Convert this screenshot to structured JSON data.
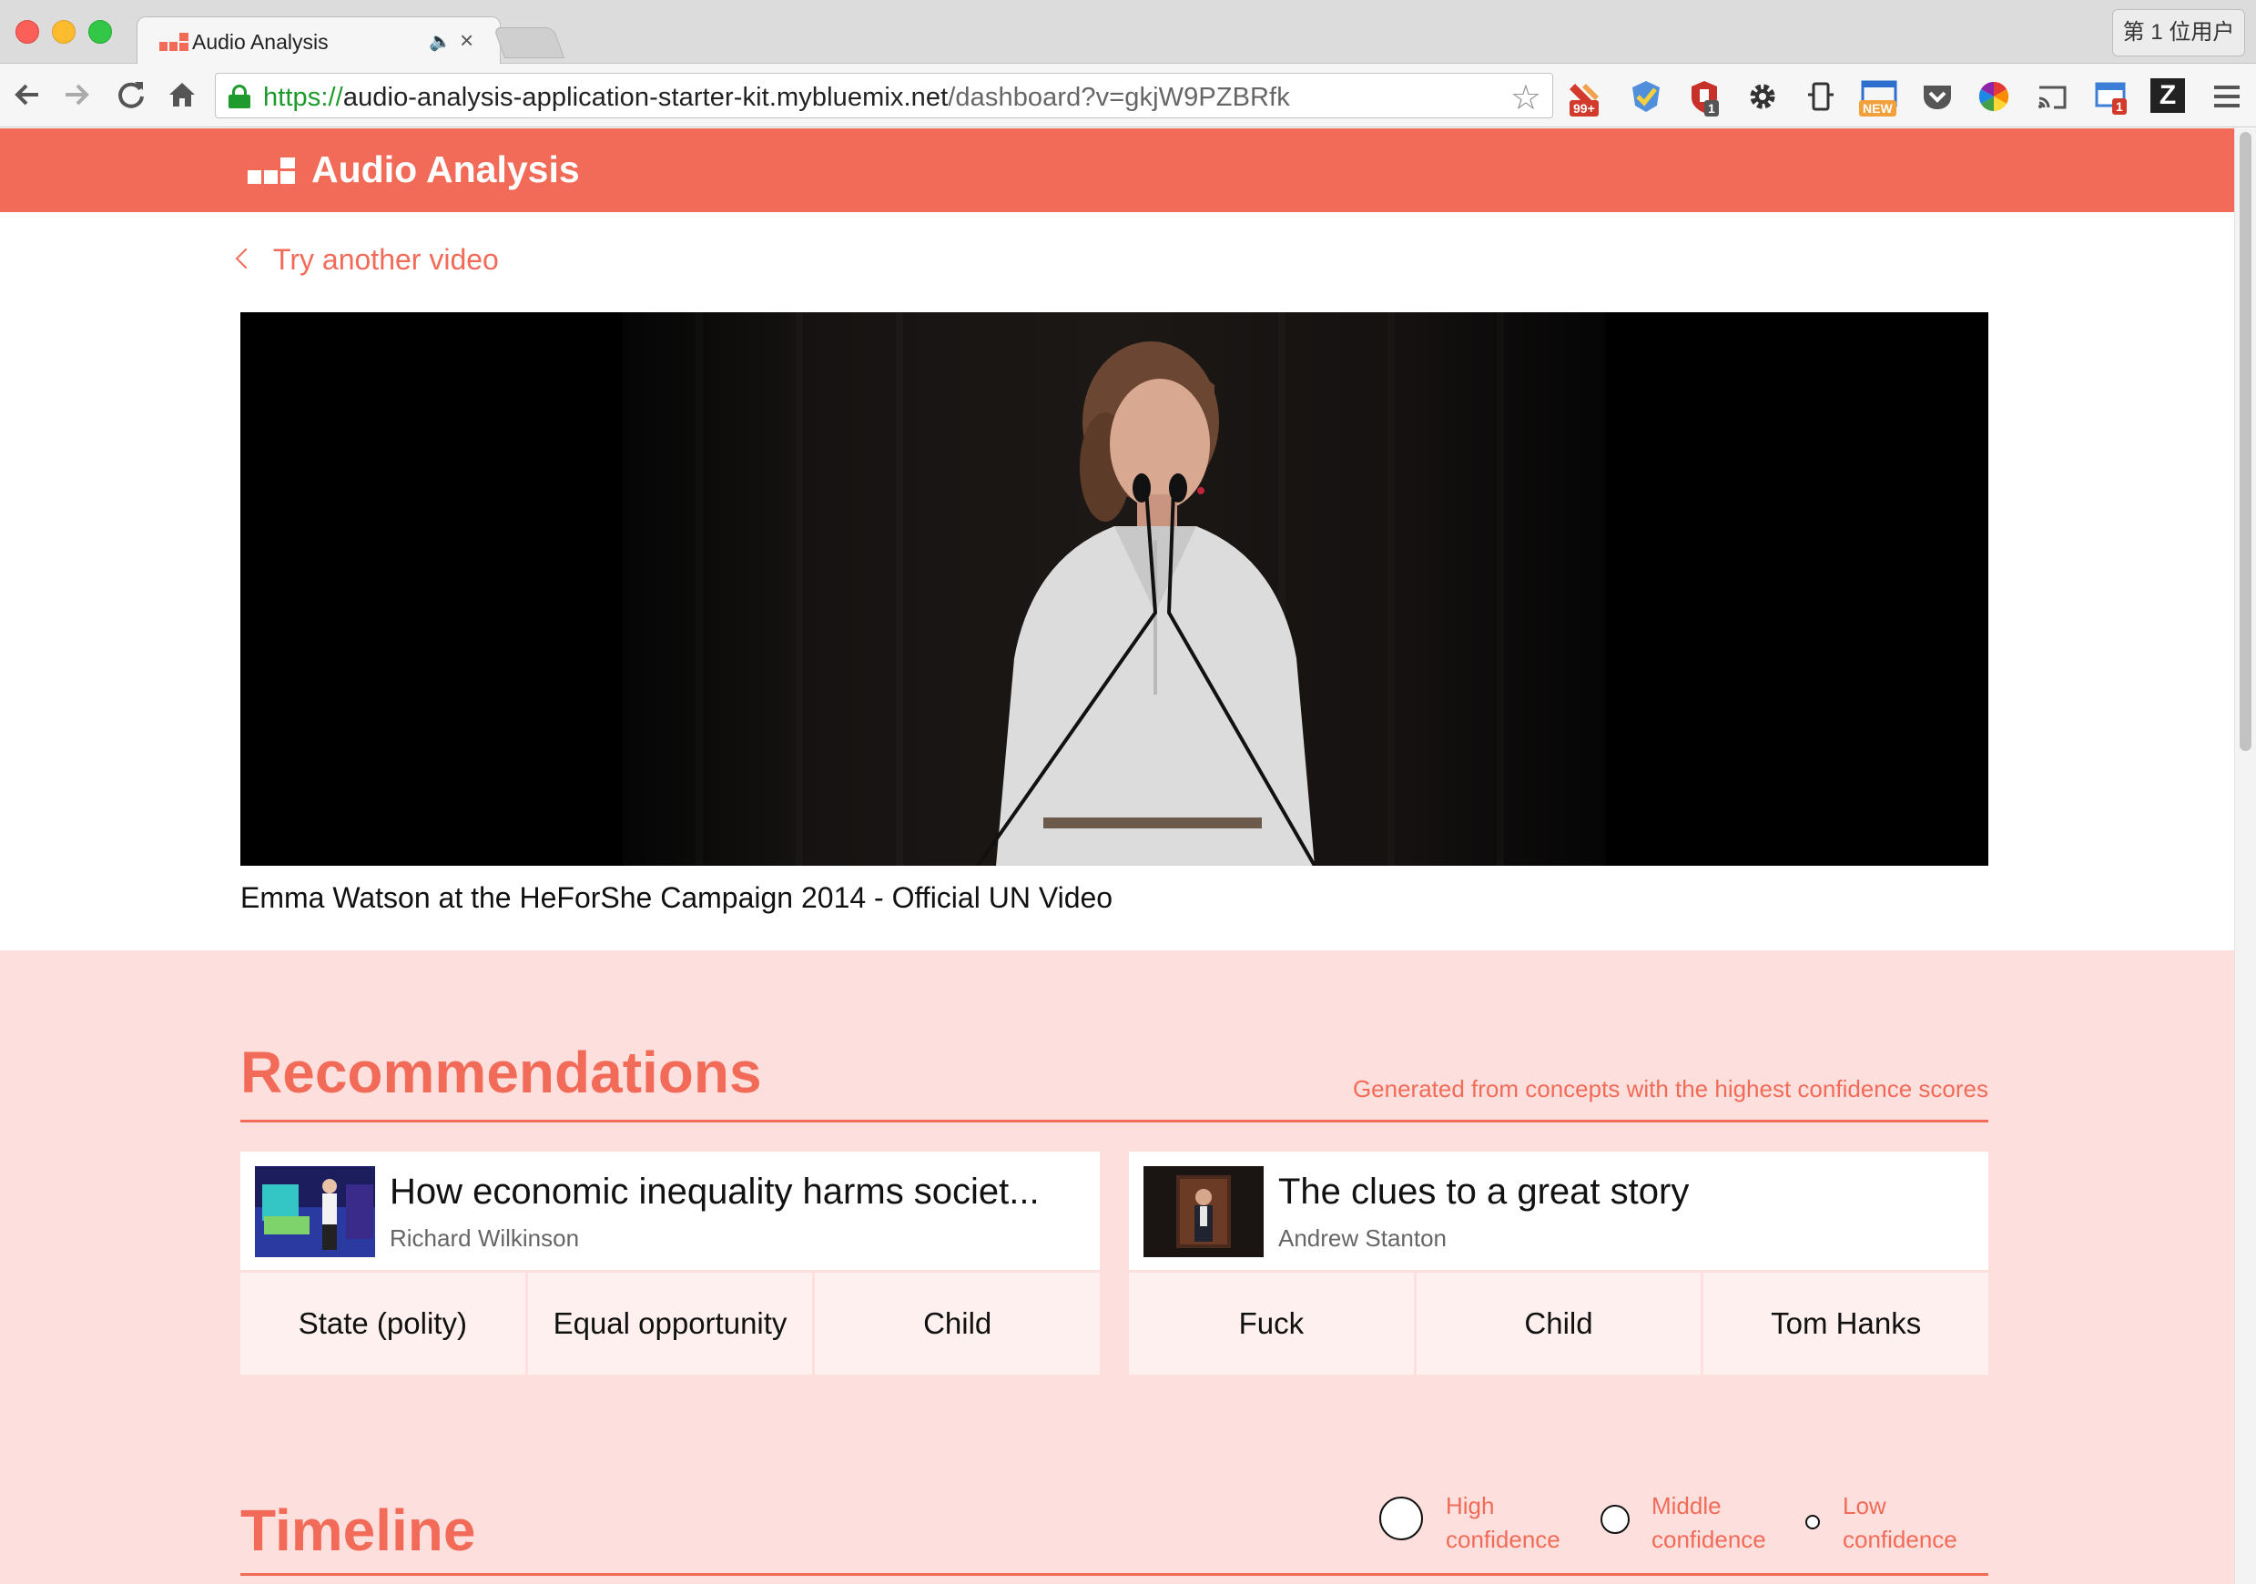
{
  "browser": {
    "tab": {
      "title": "Audio Analysis"
    },
    "user_label": "第 1 位用户",
    "url": {
      "scheme": "https://",
      "host": "audio-analysis-application-starter-kit.mybluemix.net",
      "path": "/dashboard?v=gkjW9PZBRfk"
    },
    "extensions": [
      {
        "icon": "lastpass-icon",
        "badge": "99+"
      },
      {
        "icon": "checkmark-shield-icon"
      },
      {
        "icon": "ublock-icon",
        "badge": "1"
      },
      {
        "icon": "gear-icon"
      },
      {
        "icon": "device-icon"
      },
      {
        "icon": "new-tab-icon",
        "badge": "NEW"
      },
      {
        "icon": "pocket-icon"
      },
      {
        "icon": "color-wheel-icon"
      },
      {
        "icon": "cast-icon"
      },
      {
        "icon": "calendar-icon",
        "badge": "1"
      },
      {
        "icon": "zotero-icon",
        "label": "Z"
      },
      {
        "icon": "menu-icon"
      }
    ]
  },
  "app": {
    "title": "Audio Analysis",
    "accent": "#f26b58",
    "back_link": "Try another video"
  },
  "video": {
    "title": "Emma Watson at the HeForShe Campaign 2014 - Official UN Video"
  },
  "recommendations": {
    "heading": "Recommendations",
    "subtitle": "Generated from concepts with the highest confidence scores",
    "items": [
      {
        "title": "How economic inequality harms societ...",
        "author": "Richard Wilkinson",
        "tags": [
          "State (polity)",
          "Equal opportunity",
          "Child"
        ]
      },
      {
        "title": "The clues to a great story",
        "author": "Andrew Stanton",
        "tags": [
          "Fuck",
          "Child",
          "Tom Hanks"
        ]
      }
    ]
  },
  "timeline": {
    "heading": "Timeline",
    "legend": [
      {
        "label": "High\nconfidence"
      },
      {
        "label": "Middle\nconfidence"
      },
      {
        "label": "Low\nconfidence"
      }
    ]
  }
}
